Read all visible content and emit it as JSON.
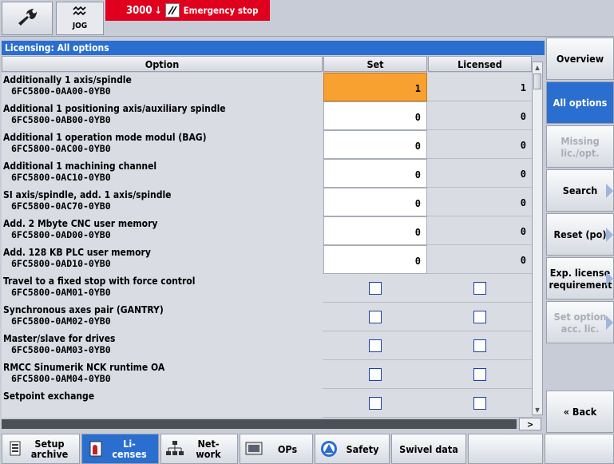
{
  "header": {
    "mode": "JOG",
    "alarm_number": "3000",
    "alarm_arrow": "↓",
    "alarm_text": "Emergency stop",
    "icons": {
      "tool": "wrench-icon",
      "mode": "jog-icon",
      "ack": "acknowledge-icon"
    }
  },
  "panel": {
    "title": "Licensing: All options",
    "columns": {
      "option": "Option",
      "set": "Set",
      "licensed": "Licensed"
    },
    "rows": [
      {
        "name": "Additionally 1 axis/spindle",
        "code": "6FC5800-0AA00-0YB0",
        "set": "1",
        "licensed": "1",
        "kind": "number",
        "active": true
      },
      {
        "name": "Additional 1 positioning axis/auxiliary spindle",
        "code": "6FC5800-0AB00-0YB0",
        "set": "0",
        "licensed": "0",
        "kind": "number"
      },
      {
        "name": "Additional 1 operation mode modul (BAG)",
        "code": "6FC5800-0AC00-0YB0",
        "set": "0",
        "licensed": "0",
        "kind": "number"
      },
      {
        "name": "Additional 1 machining channel",
        "code": "6FC5800-0AC10-0YB0",
        "set": "0",
        "licensed": "0",
        "kind": "number"
      },
      {
        "name": "SI axis/spindle, add. 1 axis/spindle",
        "code": "6FC5800-0AC70-0YB0",
        "set": "0",
        "licensed": "0",
        "kind": "number"
      },
      {
        "name": "Add. 2 Mbyte CNC user memory",
        "code": "6FC5800-0AD00-0YB0",
        "set": "0",
        "licensed": "0",
        "kind": "number"
      },
      {
        "name": "Add. 128 KB PLC user memory",
        "code": "6FC5800-0AD10-0YB0",
        "set": "0",
        "licensed": "0",
        "kind": "number"
      },
      {
        "name": "Travel to a fixed stop with force control",
        "code": "6FC5800-0AM01-0YB0",
        "kind": "check"
      },
      {
        "name": "Synchronous axes pair (GANTRY)",
        "code": "6FC5800-0AM02-0YB0",
        "kind": "check"
      },
      {
        "name": "Master/slave for drives",
        "code": "6FC5800-0AM03-0YB0",
        "kind": "check"
      },
      {
        "name": "RMCC Sinumerik NCK runtime OA",
        "code": "6FC5800-0AM04-0YB0",
        "kind": "check"
      },
      {
        "name": "Setpoint exchange",
        "code": "",
        "kind": "check"
      }
    ]
  },
  "scroll": {
    "right_label": ">"
  },
  "softkeys_right": [
    {
      "label": "Overview",
      "state": "normal",
      "arrow": false
    },
    {
      "label": "All options",
      "state": "selected",
      "arrow": false
    },
    {
      "label": "Missing lic./opt.",
      "state": "disabled",
      "arrow": false
    },
    {
      "label": "Search",
      "state": "normal",
      "arrow": true
    },
    {
      "label": "Reset (po)",
      "state": "normal",
      "arrow": true
    },
    {
      "label": "Exp. license requirement",
      "state": "normal",
      "arrow": true
    },
    {
      "label": "Set option acc. lic.",
      "state": "disabled",
      "arrow": true
    },
    {
      "label": "« Back",
      "state": "normal",
      "arrow": false
    }
  ],
  "softkeys_bottom": [
    {
      "label": "Setup archive",
      "icon": "archive-icon",
      "state": "normal"
    },
    {
      "label": "Li- censes",
      "icon": "license-icon",
      "state": "selected"
    },
    {
      "label": "Net- work",
      "icon": "network-icon",
      "state": "normal"
    },
    {
      "label": "OPs",
      "icon": "operator-panel-icon",
      "state": "normal"
    },
    {
      "label": "Safety",
      "icon": "safety-icon",
      "state": "normal"
    },
    {
      "label": "Swivel data",
      "icon": "",
      "state": "normal"
    },
    {
      "label": "",
      "icon": "",
      "state": "normal"
    },
    {
      "label": "",
      "icon": "",
      "state": "normal"
    }
  ]
}
